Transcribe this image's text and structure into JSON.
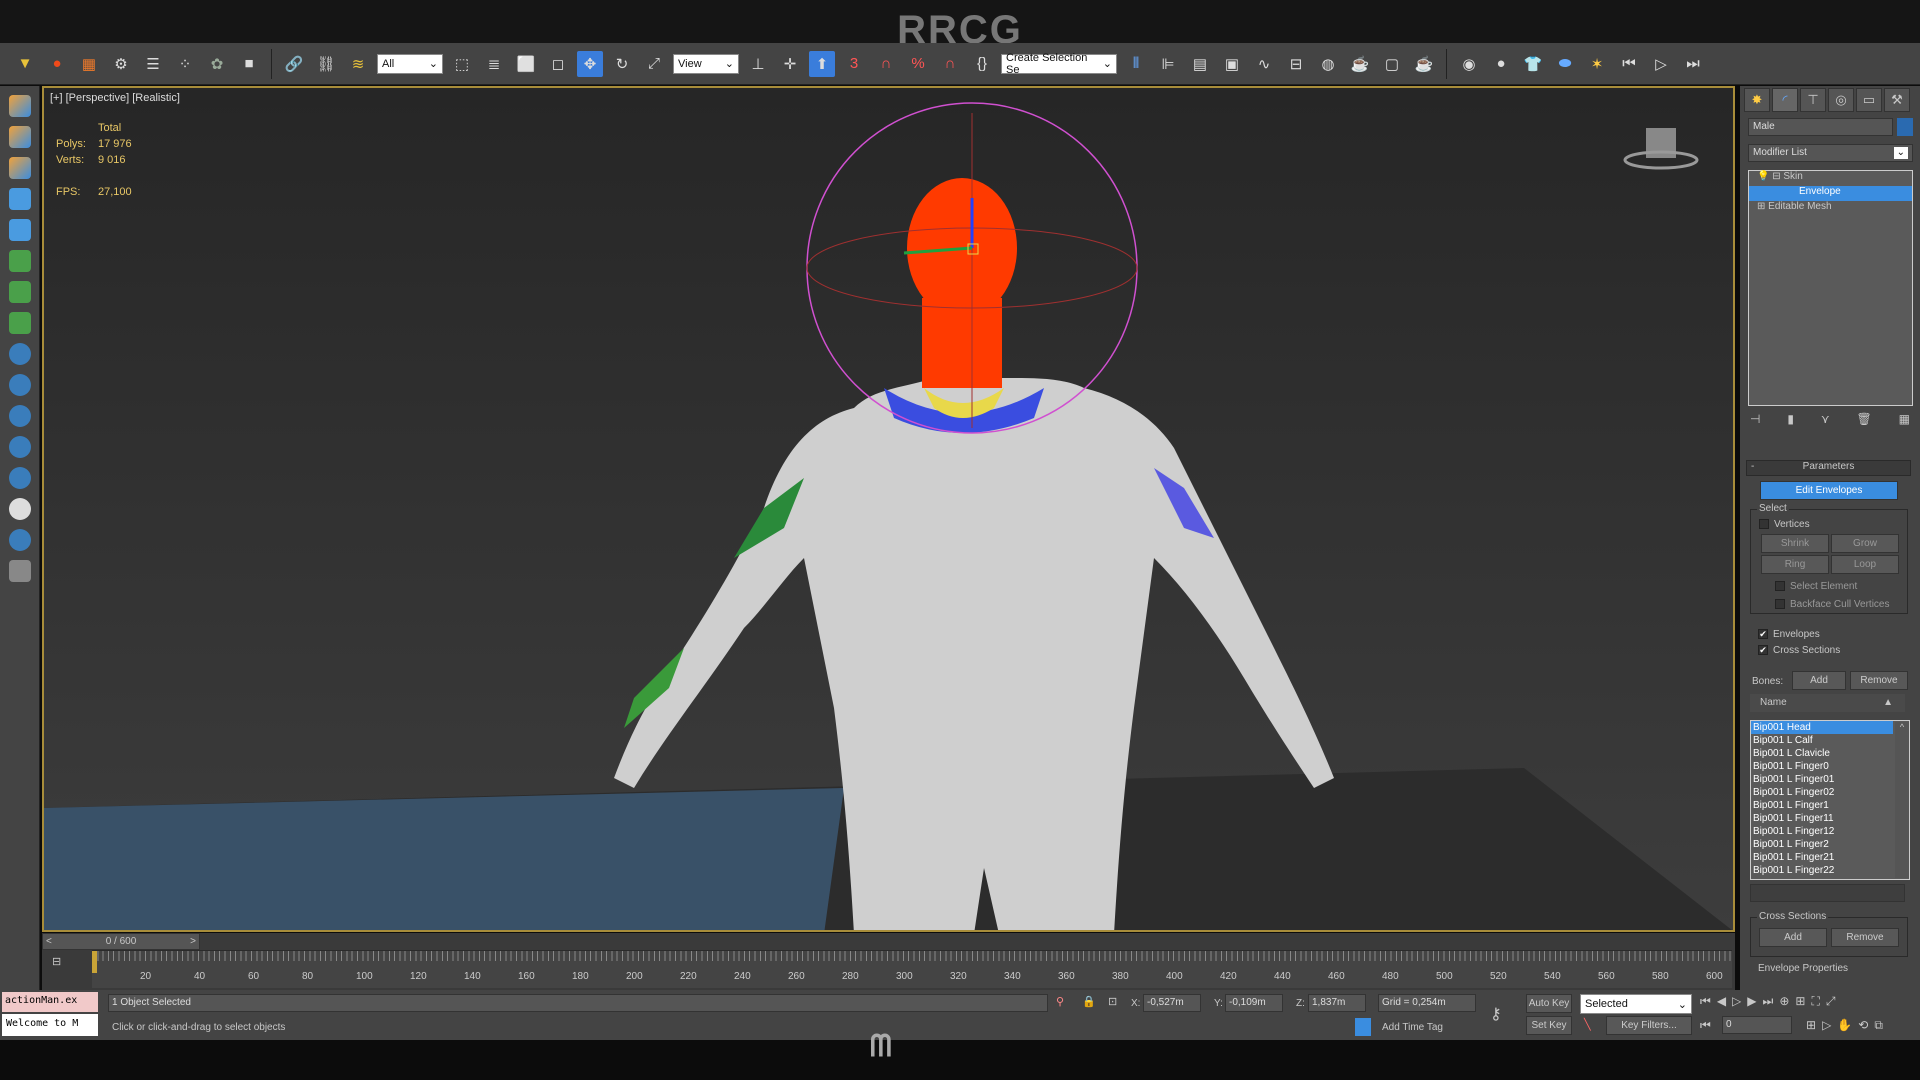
{
  "brand": "RRCG",
  "toolbar": {
    "filter": "All",
    "coord_system": "View",
    "selection_set": "Create Selection Se",
    "snap_label": "3"
  },
  "viewport": {
    "label": "[+] [Perspective] [Realistic]",
    "stats": {
      "total": "Total",
      "polys_label": "Polys:",
      "polys": "17 976",
      "verts_label": "Verts:",
      "verts": "9 016",
      "fps_label": "FPS:",
      "fps": "27,100"
    }
  },
  "panel": {
    "object_name": "Male",
    "modifier_list": "Modifier List",
    "stack": [
      "Skin",
      "Envelope",
      "Editable Mesh"
    ],
    "parameters": "Parameters",
    "edit_envelopes": "Edit Envelopes",
    "select": "Select",
    "vertices": "Vertices",
    "shrink": "Shrink",
    "grow": "Grow",
    "ring": "Ring",
    "loop": "Loop",
    "select_element": "Select Element",
    "backface": "Backface Cull Vertices",
    "envelopes": "Envelopes",
    "cross_sections": "Cross Sections",
    "bones_label": "Bones:",
    "add": "Add",
    "remove": "Remove",
    "name_col": "Name",
    "bones": [
      "Bip001 Head",
      "Bip001 L Calf",
      "Bip001 L Clavicle",
      "Bip001 L Finger0",
      "Bip001 L Finger01",
      "Bip001 L Finger02",
      "Bip001 L Finger1",
      "Bip001 L Finger11",
      "Bip001 L Finger12",
      "Bip001 L Finger2",
      "Bip001 L Finger21",
      "Bip001 L Finger22"
    ],
    "cs_group": "Cross Sections",
    "env_props": "Envelope Properties",
    "checks": {
      "vertices": false,
      "select_element": false,
      "backface": false,
      "envelopes": true,
      "cross_sections": true
    }
  },
  "timeline": {
    "frame": "0 / 600",
    "ticks": [
      "20",
      "40",
      "60",
      "80",
      "100",
      "120",
      "140",
      "160",
      "180",
      "200",
      "220",
      "240",
      "260",
      "280",
      "300",
      "320",
      "340",
      "360",
      "380",
      "400",
      "420",
      "440",
      "460",
      "480",
      "500",
      "520",
      "540",
      "560",
      "580",
      "600"
    ]
  },
  "status": {
    "script1": "actionMan.ex",
    "script2": "Welcome to M",
    "selected": "1 Object Selected",
    "prompt": "Click or click-and-drag to select objects",
    "x_label": "X:",
    "x": "-0,527m",
    "y_label": "Y:",
    "y": "-0,109m",
    "z_label": "Z:",
    "z": "1,837m",
    "grid": "Grid = 0,254m",
    "auto_key": "Auto Key",
    "key_mode": "Selected",
    "set_key": "Set Key",
    "key_filters": "Key Filters...",
    "add_time_tag": "Add Time Tag",
    "frame_field": "0"
  },
  "colors": {
    "accent": "#3a8de0",
    "viewport_border": "#a88d3a",
    "head_weight": "#ff3a00"
  }
}
